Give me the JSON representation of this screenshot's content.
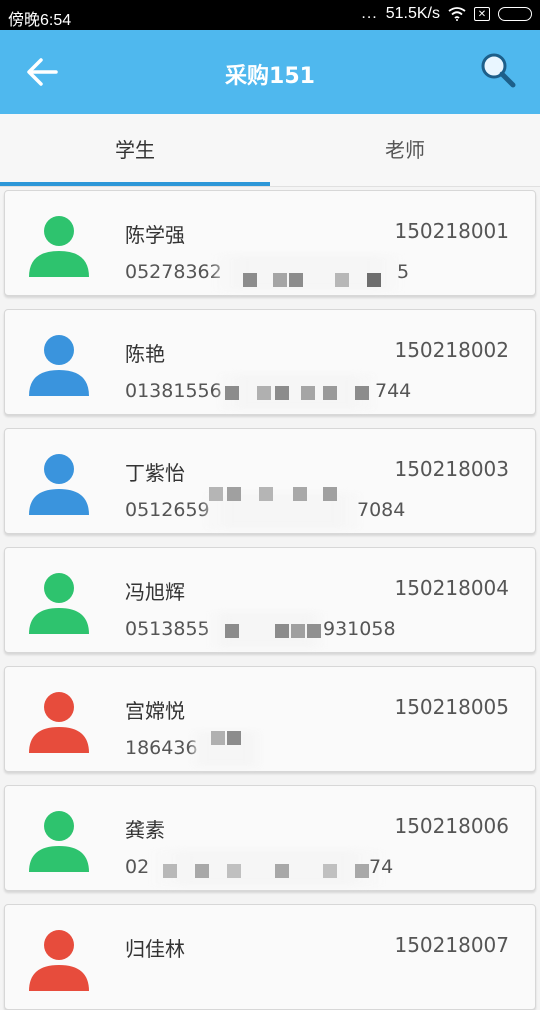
{
  "status_bar": {
    "time": "傍晚6:54",
    "dots": "...",
    "speed": "51.5K/s",
    "sim_label": "✕"
  },
  "app_bar": {
    "title": "采购151",
    "back_icon": "back-arrow-icon",
    "search_icon": "search-icon"
  },
  "tabs": [
    {
      "label": "学生",
      "active": true
    },
    {
      "label": "老师",
      "active": false
    }
  ],
  "colors": {
    "app_bar": "#4fb8ee",
    "tab_indicator": "#2d97d8",
    "green": "#2ec36e",
    "blue": "#3a94dd",
    "red": "#e74c3c"
  },
  "students": [
    {
      "name": "陈学强",
      "id": "150218001",
      "phone": "05278362",
      "phone_tail": "5",
      "color": "green"
    },
    {
      "name": "陈艳",
      "id": "150218002",
      "phone": "01381556",
      "phone_tail": "744",
      "color": "blue"
    },
    {
      "name": "丁紫怡",
      "id": "150218003",
      "phone": "0512659",
      "phone_tail": "7084",
      "color": "blue"
    },
    {
      "name": "冯旭辉",
      "id": "150218004",
      "phone": "0513855",
      "phone_tail": "931058",
      "color": "green"
    },
    {
      "name": "宫嫦悦",
      "id": "150218005",
      "phone": "186436",
      "phone_tail": "",
      "color": "red"
    },
    {
      "name": "龚素",
      "id": "150218006",
      "phone": "02",
      "phone_tail": "74",
      "color": "green"
    },
    {
      "name": "归佳林",
      "id": "150218007",
      "phone": "",
      "phone_tail": "",
      "color": "red"
    }
  ]
}
